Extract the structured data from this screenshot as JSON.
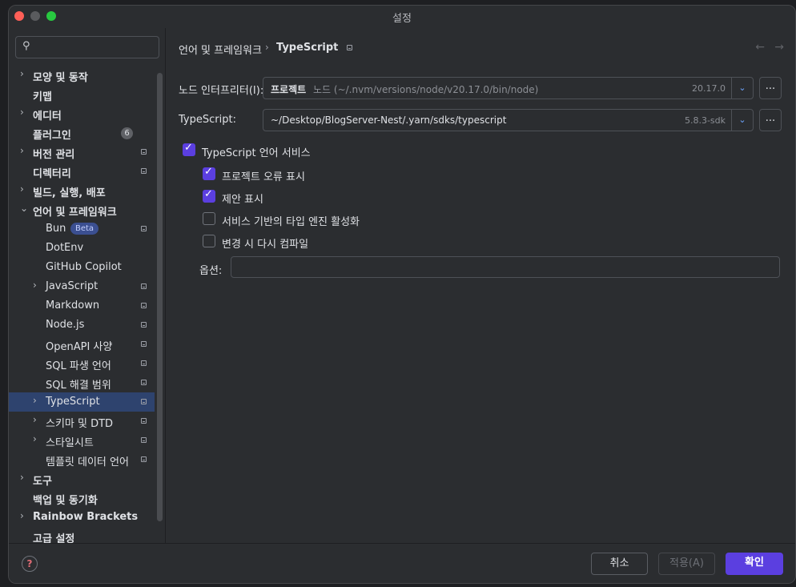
{
  "window": {
    "title": "설정"
  },
  "search": {
    "placeholder": ""
  },
  "sidebar": {
    "items": [
      {
        "label": "모양 및 동작",
        "chevron": "›",
        "bold": true
      },
      {
        "label": "키맵",
        "bold": true
      },
      {
        "label": "에디터",
        "chevron": "›",
        "bold": true
      },
      {
        "label": "플러그인",
        "bold": true,
        "badge": "6"
      },
      {
        "label": "버전 관리",
        "chevron": "›",
        "bold": true
      },
      {
        "label": "디렉터리",
        "bold": true
      },
      {
        "label": "빌드, 실행, 배포",
        "chevron": "›",
        "bold": true
      },
      {
        "label": "언어 및 프레임워크",
        "chevron": "⌄",
        "bold": true
      },
      {
        "label": "Bun",
        "beta": "Beta"
      },
      {
        "label": "DotEnv"
      },
      {
        "label": "GitHub Copilot"
      },
      {
        "label": "JavaScript",
        "chevron": "›"
      },
      {
        "label": "Markdown"
      },
      {
        "label": "Node.js"
      },
      {
        "label": "OpenAPI 사양"
      },
      {
        "label": "SQL 파생 언어"
      },
      {
        "label": "SQL 해결 범위"
      },
      {
        "label": "TypeScript",
        "chevron": "›",
        "selected": true
      },
      {
        "label": "스키마 및 DTD",
        "chevron": "›"
      },
      {
        "label": "스타일시트",
        "chevron": "›"
      },
      {
        "label": "템플릿 데이터 언어"
      },
      {
        "label": "도구",
        "chevron": "›",
        "bold": true
      },
      {
        "label": "백업 및 동기화",
        "bold": true
      },
      {
        "label": "Rainbow Brackets",
        "chevron": "›",
        "bold": true
      },
      {
        "label": "고급 설정",
        "bold": true
      }
    ]
  },
  "breadcrumb": {
    "parent": "언어 및 프레임워크",
    "separator": "›",
    "current": "TypeScript"
  },
  "nav": {
    "back": "←",
    "forward": "→"
  },
  "node_interpreter": {
    "label": "노드 인터프리터(I):",
    "tag": "프로젝트",
    "path": "노드 (~/.nvm/versions/node/v20.17.0/bin/node)",
    "version": "20.17.0",
    "more": "..."
  },
  "typescript": {
    "label": "TypeScript:",
    "path": "~/Desktop/BlogServer-Nest/.yarn/sdks/typescript",
    "version": "5.8.3-sdk",
    "more": "..."
  },
  "checkboxes": [
    {
      "label": "TypeScript 언어 서비스",
      "checked": true
    },
    {
      "label": "프로젝트 오류 표시",
      "checked": true
    },
    {
      "label": "제안 표시",
      "checked": true
    },
    {
      "label": "서비스 기반의 타입 엔진 활성화",
      "checked": false
    },
    {
      "label": "변경 시 다시 컴파일",
      "checked": false
    }
  ],
  "options": {
    "label": "옵션:",
    "value": ""
  },
  "footer": {
    "help": "?",
    "cancel": "취소",
    "apply": "적용(A)",
    "ok": "확인"
  },
  "colors": {
    "accent": "#5b3fe0",
    "selection": "#2e436e",
    "background": "#2b2d30"
  }
}
